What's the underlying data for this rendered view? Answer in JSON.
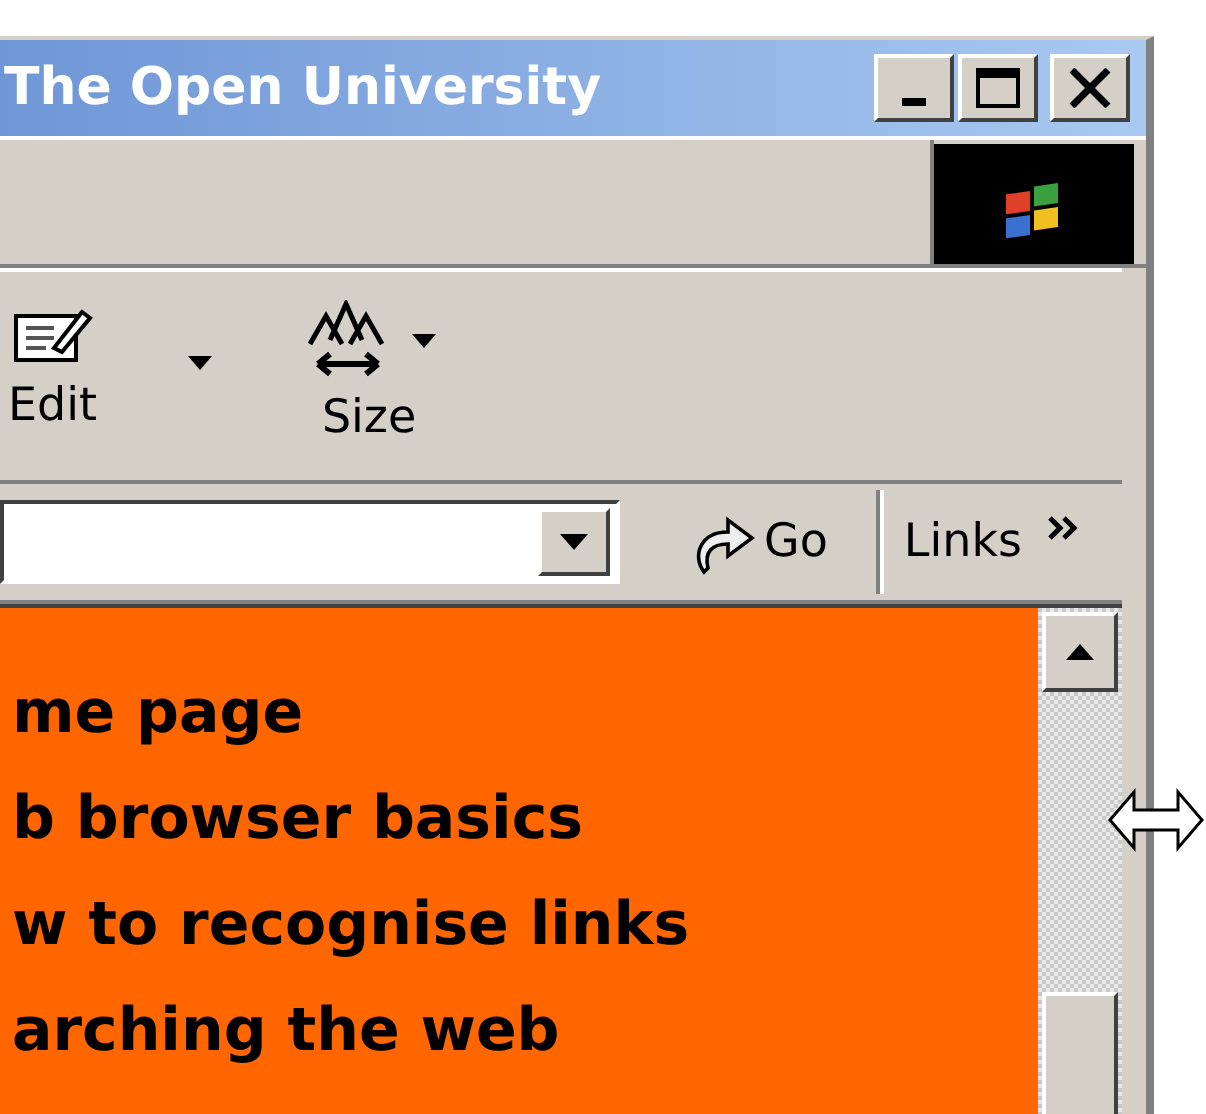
{
  "window": {
    "title": "The Open University"
  },
  "toolbar": {
    "items": [
      {
        "kind": "edit",
        "label": "Edit",
        "dropdown": false
      },
      {
        "kind": "arrow"
      },
      {
        "kind": "size",
        "label": "Size",
        "dropdown": true
      }
    ]
  },
  "address_bar": {
    "go_button": "Go",
    "links": "Links"
  },
  "page": {
    "items": [
      "me page",
      "b browser basics",
      "w to recognise links",
      "arching the web"
    ]
  }
}
